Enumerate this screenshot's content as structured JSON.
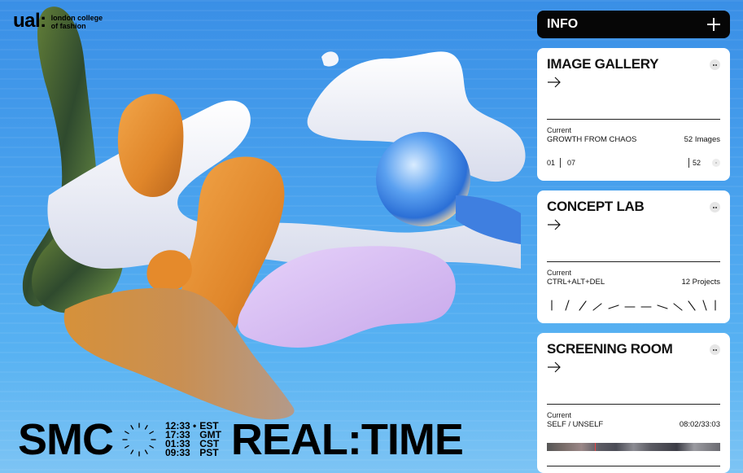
{
  "logo": {
    "mark": "ual:",
    "subline_1": "london college",
    "subline_2": "of fashion"
  },
  "bottom": {
    "left_word": "SMC",
    "right_word": "REAL:TIME",
    "zones": [
      {
        "time": "12:33 •",
        "zone": "EST"
      },
      {
        "time": "17:33",
        "zone": "GMT"
      },
      {
        "time": "01:33",
        "zone": "CST"
      },
      {
        "time": "09:33",
        "zone": "PST"
      }
    ]
  },
  "sidebar": {
    "info_label": "INFO",
    "cards": [
      {
        "title": "IMAGE GALLERY",
        "current_label": "Current",
        "current_name": "GROWTH FROM CHAOS",
        "count": "52 Images",
        "pager_start": "01",
        "pager_current": "07",
        "pager_total": "52"
      },
      {
        "title": "CONCEPT LAB",
        "current_label": "Current",
        "current_name": "CTRL+ALT+DEL",
        "count": "12 Projects"
      },
      {
        "title": "SCREENING ROOM",
        "current_label": "Current",
        "current_name": "SELF / UNSELF",
        "count": "08:02/33:03",
        "video_progress": 0.24
      }
    ]
  },
  "colors": {
    "sky": "#4a9ee8",
    "accent_dark": "#060606",
    "card_bg": "#ffffff",
    "orange": "#e08a2e",
    "lilac": "#d3b8ef",
    "white_blob": "#eef0f8"
  },
  "icons": [
    "plus-icon",
    "arrow-right-icon",
    "more-icon",
    "clock-dial-icon"
  ]
}
